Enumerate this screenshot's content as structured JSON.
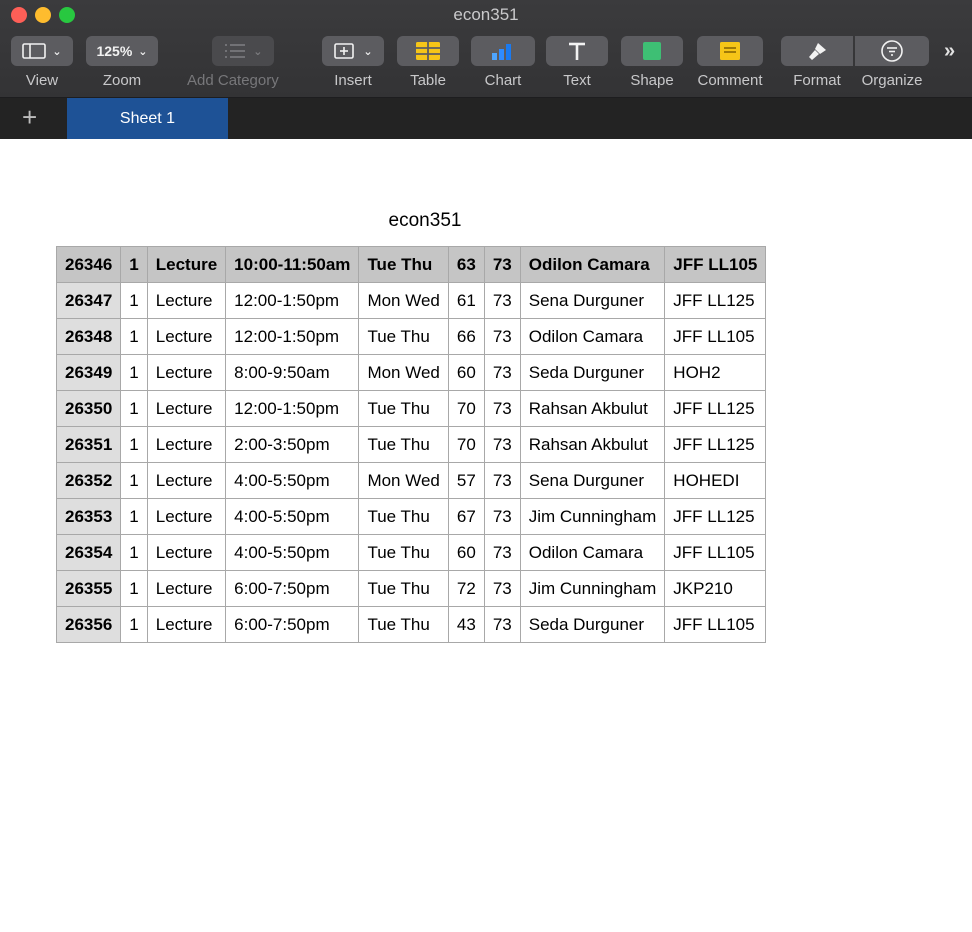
{
  "window": {
    "title": "econ351"
  },
  "toolbar": {
    "view": "View",
    "zoom": "Zoom",
    "zoom_value": "125%",
    "add_category": "Add Category",
    "insert": "Insert",
    "table": "Table",
    "chart": "Chart",
    "text": "Text",
    "shape": "Shape",
    "comment": "Comment",
    "format": "Format",
    "organize": "Organize",
    "overflow": "»"
  },
  "tabs": {
    "add": "+",
    "sheet1": "Sheet 1"
  },
  "colors": {
    "tab_active": "#1e5296",
    "header_fill": "#c5c5c5",
    "id_col_fill": "#dedede"
  },
  "sheet": {
    "title": "econ351",
    "header_row": [
      "26346",
      "1",
      "Lecture",
      "10:00-11:50am",
      "Tue  Thu",
      "63",
      "73",
      "Odilon Camara",
      "JFF LL105"
    ],
    "rows": [
      [
        "26347",
        "1",
        "Lecture",
        "12:00-1:50pm",
        "Mon  Wed",
        "61",
        "73",
        "Sena Durguner",
        "JFF LL125"
      ],
      [
        "26348",
        "1",
        "Lecture",
        "12:00-1:50pm",
        "Tue  Thu",
        "66",
        "73",
        "Odilon Camara",
        "JFF LL105"
      ],
      [
        "26349",
        "1",
        "Lecture",
        "8:00-9:50am",
        "Mon  Wed",
        "60",
        "73",
        "Seda Durguner",
        "HOH2"
      ],
      [
        "26350",
        "1",
        "Lecture",
        "12:00-1:50pm",
        "Tue  Thu",
        "70",
        "73",
        "Rahsan Akbulut",
        "JFF LL125"
      ],
      [
        "26351",
        "1",
        "Lecture",
        "2:00-3:50pm",
        "Tue  Thu",
        "70",
        "73",
        "Rahsan Akbulut",
        "JFF LL125"
      ],
      [
        "26352",
        "1",
        "Lecture",
        "4:00-5:50pm",
        "Mon  Wed",
        "57",
        "73",
        "Sena Durguner",
        "HOHEDI"
      ],
      [
        "26353",
        "1",
        "Lecture",
        "4:00-5:50pm",
        "Tue  Thu",
        "67",
        "73",
        "Jim Cunningham",
        "JFF LL125"
      ],
      [
        "26354",
        "1",
        "Lecture",
        "4:00-5:50pm",
        "Tue  Thu",
        "60",
        "73",
        "Odilon Camara",
        "JFF LL105"
      ],
      [
        "26355",
        "1",
        "Lecture",
        "6:00-7:50pm",
        "Tue  Thu",
        "72",
        "73",
        "Jim Cunningham",
        "JKP210"
      ],
      [
        "26356",
        "1",
        "Lecture",
        "6:00-7:50pm",
        "Tue  Thu",
        "43",
        "73",
        "Seda Durguner",
        "JFF LL105"
      ]
    ]
  }
}
